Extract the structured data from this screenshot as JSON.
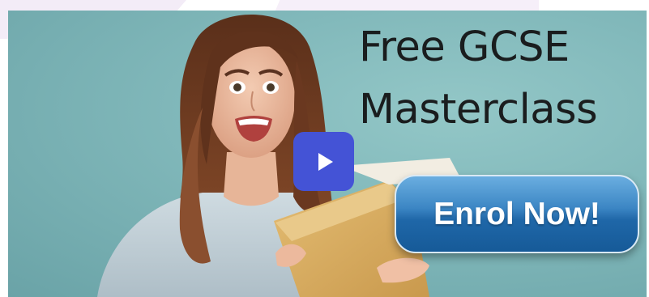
{
  "video": {
    "headline_line1": "Free GCSE",
    "headline_line2": "Masterclass",
    "cta_label": "Enrol Now!",
    "play_icon": "play-icon",
    "thumbnail_subject": "excited-student-with-envelope-photo"
  },
  "colors": {
    "background_teal": "#82b9bb",
    "play_button": "#4453d6",
    "cta_blue": "#1f67a8",
    "headline_text": "#1a1d1e",
    "envelope": "#d7ad62",
    "sweater": "#c6d3da",
    "hair": "#6b3a22"
  }
}
